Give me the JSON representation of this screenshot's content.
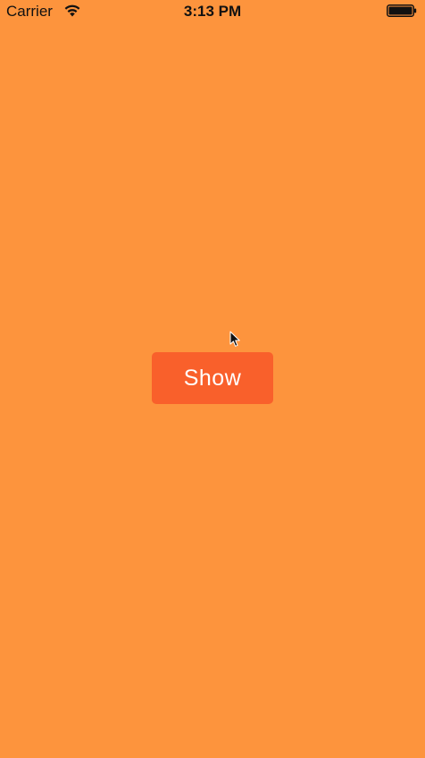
{
  "colors": {
    "background": "#fd943d",
    "button": "#f9602b",
    "button_text": "#ffffff"
  },
  "status_bar": {
    "carrier": "Carrier",
    "time": "3:13 PM",
    "icons": [
      "wifi-icon",
      "battery-icon"
    ]
  },
  "main": {
    "show_button_label": "Show"
  }
}
